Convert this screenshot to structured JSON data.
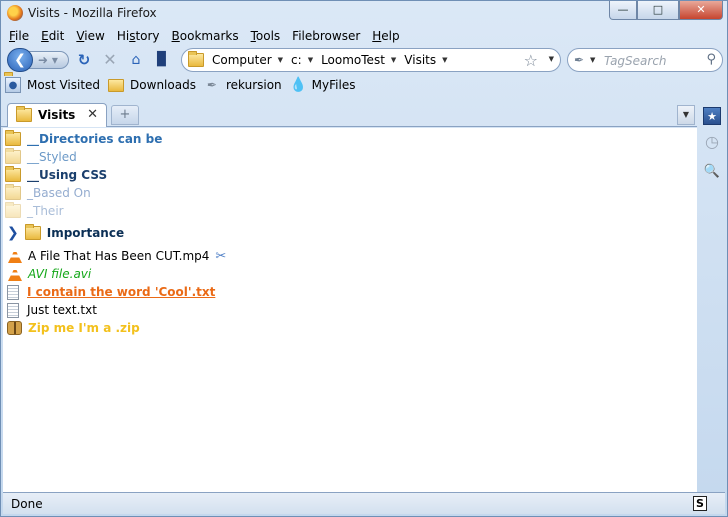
{
  "window": {
    "title": "Visits - Mozilla Firefox"
  },
  "window_buttons": {
    "minimize": "—",
    "maximize": "□",
    "close": "✕"
  },
  "menu": [
    {
      "key": "F",
      "rest": "ile"
    },
    {
      "key": "E",
      "rest": "dit"
    },
    {
      "key": "V",
      "rest": "iew"
    },
    {
      "key": "",
      "rest": "Hi",
      "key2": "s",
      "rest2": "tory"
    },
    {
      "key": "B",
      "rest": "ookmarks"
    },
    {
      "key": "T",
      "rest": "ools"
    },
    {
      "key": "",
      "rest": "Filebrowser"
    },
    {
      "key": "H",
      "rest": "elp"
    }
  ],
  "nav": {
    "crumbs": [
      "Computer",
      "c:",
      "LoomoTest",
      "Visits"
    ],
    "search_placeholder": "TagSearch"
  },
  "bookmarks": [
    {
      "label": "Most Visited",
      "icon": "most-visited-icon"
    },
    {
      "label": "Downloads",
      "icon": "folder-icon"
    },
    {
      "label": "rekursion",
      "icon": "tag-icon"
    },
    {
      "label": "MyFiles",
      "icon": "droplet-icon"
    }
  ],
  "tab": {
    "label": "Visits",
    "close": "✕",
    "new": "+"
  },
  "files": {
    "dir1": "__Directories can be",
    "dir2": "__Styled",
    "dir3": "__Using CSS",
    "dir4": "_Based On",
    "dir5": "_Their",
    "dir6": "Importance",
    "file1": "A File That Has Been CUT.mp4",
    "file2": "AVI file.avi",
    "file3": "I contain the word 'Cool'.txt",
    "file4": "Just text.txt",
    "file5": "Zip me I'm a .zip"
  },
  "status": {
    "text": "Done"
  },
  "colors": {
    "accent": "#2e6fb0",
    "avi_green": "#15a81a",
    "cool_orange": "#ea6a16",
    "zip_yellow": "#f3c11d"
  }
}
